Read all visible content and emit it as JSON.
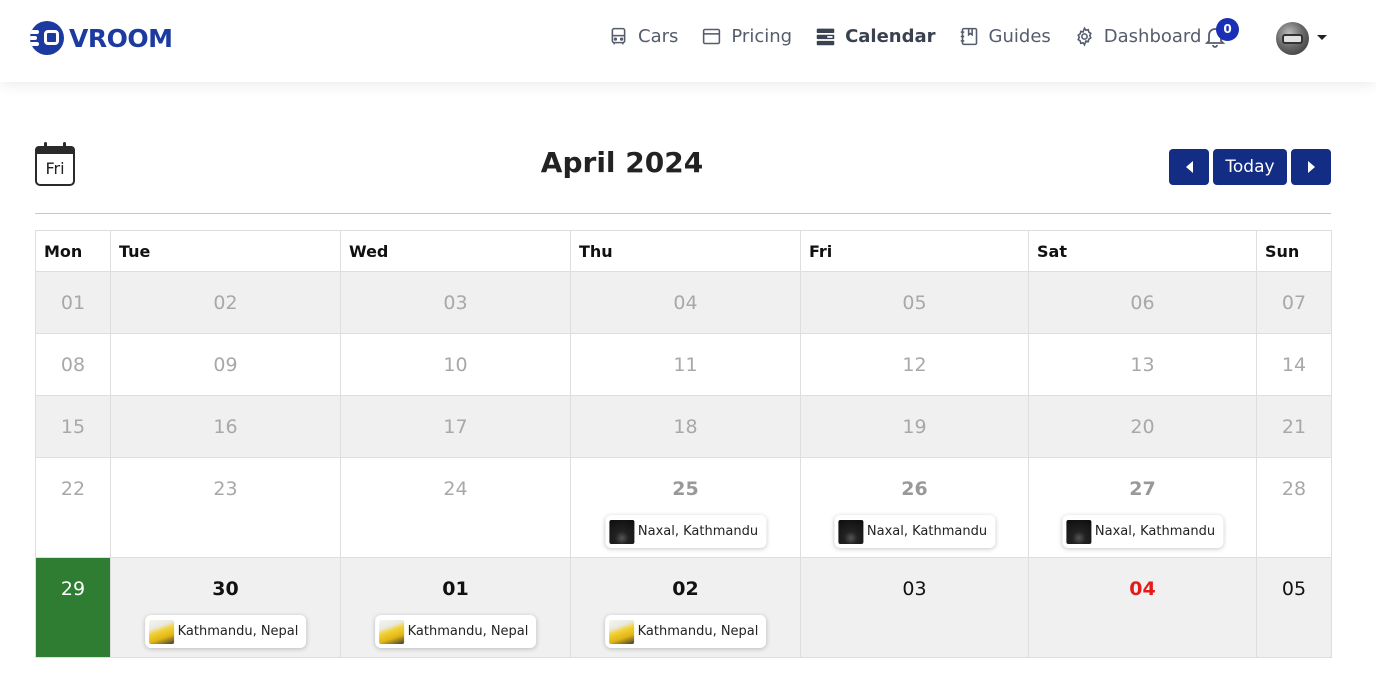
{
  "brand": {
    "name": "VROOM",
    "color": "#1c3aa0"
  },
  "nav": {
    "items": [
      {
        "label": "Cars",
        "icon": "bus-icon"
      },
      {
        "label": "Pricing",
        "icon": "window-icon"
      },
      {
        "label": "Calendar",
        "icon": "calendar-icon",
        "active": true
      },
      {
        "label": "Guides",
        "icon": "notebook-icon"
      },
      {
        "label": "Dashboard",
        "icon": "gear-icon"
      }
    ],
    "notifications_count": "0"
  },
  "calendar": {
    "icon_day": "Fri",
    "title": "April 2024",
    "today_label": "Today",
    "weekdays": [
      "Mon",
      "Tue",
      "Wed",
      "Thu",
      "Fri",
      "Sat",
      "Sun"
    ],
    "weeks": [
      {
        "days": [
          {
            "num": "01"
          },
          {
            "num": "02"
          },
          {
            "num": "03"
          },
          {
            "num": "04"
          },
          {
            "num": "05"
          },
          {
            "num": "06"
          },
          {
            "num": "07"
          }
        ]
      },
      {
        "days": [
          {
            "num": "08"
          },
          {
            "num": "09"
          },
          {
            "num": "10"
          },
          {
            "num": "11"
          },
          {
            "num": "12"
          },
          {
            "num": "13"
          },
          {
            "num": "14"
          }
        ]
      },
      {
        "days": [
          {
            "num": "15"
          },
          {
            "num": "16"
          },
          {
            "num": "17"
          },
          {
            "num": "18"
          },
          {
            "num": "19"
          },
          {
            "num": "20"
          },
          {
            "num": "21"
          }
        ]
      },
      {
        "days": [
          {
            "num": "22"
          },
          {
            "num": "23"
          },
          {
            "num": "24"
          },
          {
            "num": "25",
            "bold": true,
            "event": {
              "location": "Naxal, Kathmandu",
              "thumb": "dark-car"
            }
          },
          {
            "num": "26",
            "bold": true,
            "event": {
              "location": "Naxal, Kathmandu",
              "thumb": "dark-car"
            }
          },
          {
            "num": "27",
            "bold": true,
            "event": {
              "location": "Naxal, Kathmandu",
              "thumb": "dark-car"
            }
          },
          {
            "num": "28"
          }
        ]
      },
      {
        "days": [
          {
            "num": "29",
            "today": true
          },
          {
            "num": "30",
            "bold": true,
            "event": {
              "location": "Kathmandu, Nepal",
              "thumb": "yellow-car"
            }
          },
          {
            "num": "01",
            "bold": true,
            "event": {
              "location": "Kathmandu, Nepal",
              "thumb": "yellow-car"
            }
          },
          {
            "num": "02",
            "bold": true,
            "event": {
              "location": "Kathmandu, Nepal",
              "thumb": "yellow-car"
            }
          },
          {
            "num": "03"
          },
          {
            "num": "04",
            "red": true
          },
          {
            "num": "05"
          }
        ]
      }
    ]
  },
  "colors": {
    "primary": "#132d85",
    "today_bg": "#2e7d32",
    "weekend_highlight": "#e31b1b",
    "shade": "#f0f0f0"
  }
}
